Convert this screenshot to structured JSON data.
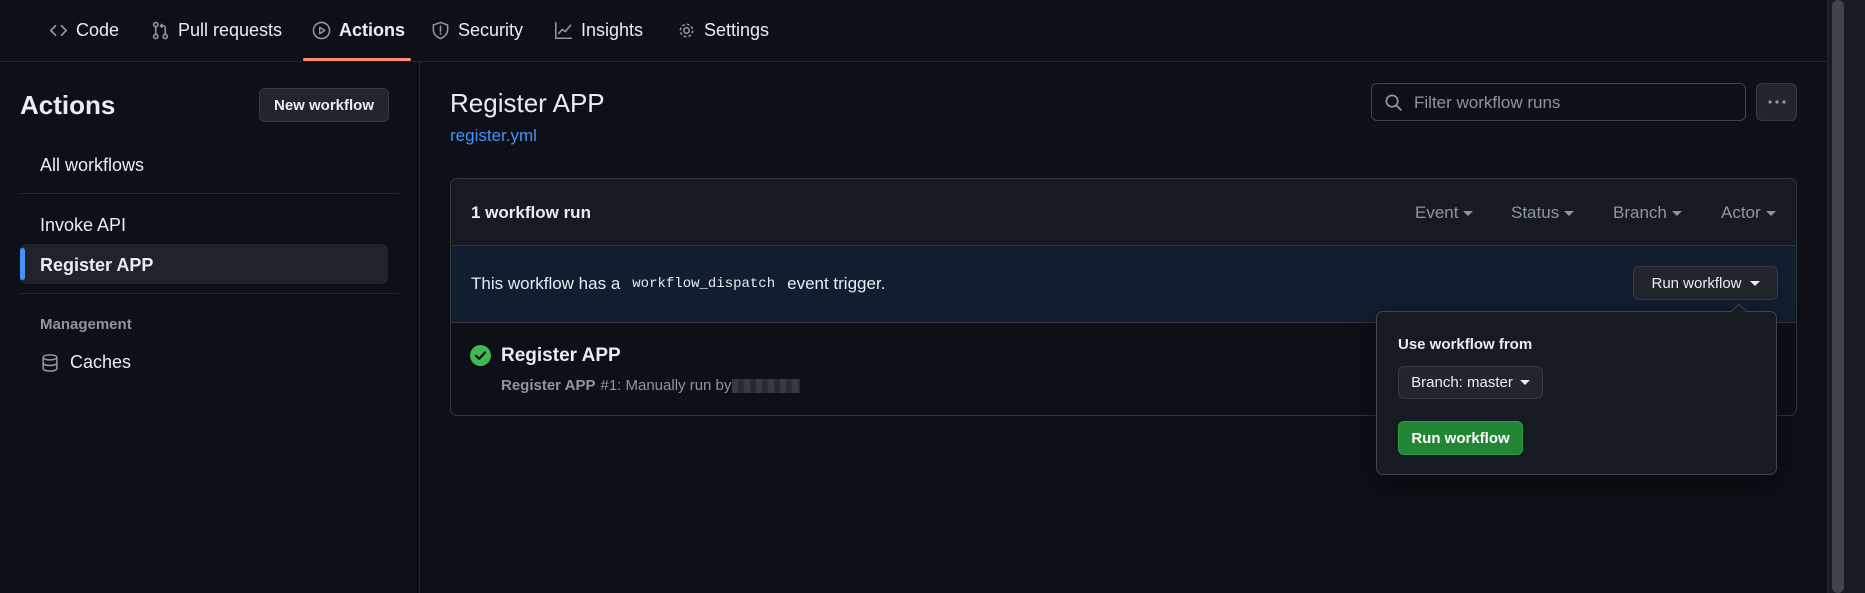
{
  "nav": {
    "tabs": [
      {
        "label": "Code",
        "icon": "code-icon"
      },
      {
        "label": "Pull requests",
        "icon": "git-pull-request-icon"
      },
      {
        "label": "Actions",
        "icon": "play-icon",
        "active": true
      },
      {
        "label": "Security",
        "icon": "shield-icon"
      },
      {
        "label": "Insights",
        "icon": "graph-icon"
      },
      {
        "label": "Settings",
        "icon": "gear-icon"
      }
    ]
  },
  "sidebar": {
    "title": "Actions",
    "new_workflow_label": "New workflow",
    "all_workflows": "All workflows",
    "workflows": [
      {
        "label": "Invoke API",
        "selected": false
      },
      {
        "label": "Register APP",
        "selected": true
      }
    ],
    "management_heading": "Management",
    "caches_label": "Caches"
  },
  "main": {
    "title": "Register APP",
    "file_link": "register.yml",
    "filter_placeholder": "Filter workflow runs",
    "runs_count": "1 workflow run",
    "filters": [
      "Event",
      "Status",
      "Branch",
      "Actor"
    ],
    "trigger": {
      "prefix": "This workflow has a",
      "code": "workflow_dispatch",
      "suffix": "event trigger.",
      "run_button": "Run workflow"
    },
    "run": {
      "title": "Register APP",
      "workflow_name": "Register APP",
      "details": "#1: Manually run by",
      "status": "success"
    }
  },
  "popover": {
    "heading": "Use workflow from",
    "branch_label": "Branch: master",
    "run_button": "Run workflow"
  },
  "colors": {
    "background": "#0d1117",
    "accent_underline": "#fd8c73",
    "link": "#4493f8",
    "success": "#3fb950",
    "primary_button": "#238636"
  }
}
